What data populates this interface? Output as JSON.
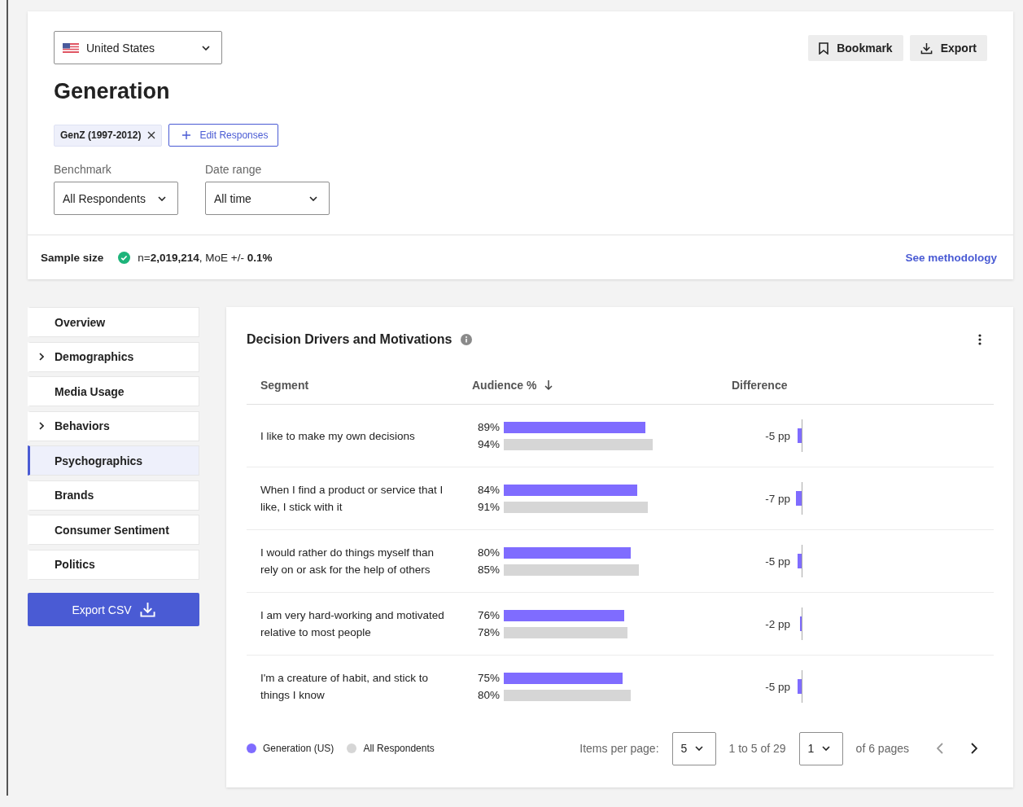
{
  "header": {
    "country": "United States",
    "title": "Generation",
    "actions": [
      {
        "label": "Bookmark",
        "kind": "bookmark"
      },
      {
        "label": "Export",
        "kind": "export"
      }
    ]
  },
  "filters": {
    "chips": [
      {
        "label": "GenZ (1997-2012)"
      }
    ],
    "edit_button": "Edit Responses",
    "benchmark": {
      "label": "Benchmark",
      "value": "All Respondents"
    },
    "date_range": {
      "label": "Date range",
      "value": "All time"
    }
  },
  "sample": {
    "label": "Sample size",
    "text": "n=**2,019,214**, MoE +/- **0.1%**",
    "link": "See methodology"
  },
  "nav": {
    "items": [
      {
        "label": "Overview",
        "expandable": false,
        "selected": false
      },
      {
        "label": "Demographics",
        "expandable": true,
        "selected": false
      },
      {
        "label": "Media Usage",
        "expandable": false,
        "selected": false
      },
      {
        "label": "Behaviors",
        "expandable": true,
        "selected": false
      },
      {
        "label": "Psychographics",
        "expandable": false,
        "selected": true
      },
      {
        "label": "Brands",
        "expandable": false,
        "selected": false
      },
      {
        "label": "Consumer Sentiment",
        "expandable": false,
        "selected": false
      },
      {
        "label": "Politics",
        "expandable": false,
        "selected": false
      }
    ],
    "export_button": "Export CSV"
  },
  "panel": {
    "title": "Decision Drivers and Motivations",
    "columns": [
      "Segment",
      "Audience %",
      "Difference"
    ],
    "rows": [
      {
        "segment": "I like to make my own decisions",
        "audience": {
          "value": "89%"
        },
        "benchmark": {
          "value": "94%"
        },
        "difference": {
          "value": "-5 pp"
        }
      },
      {
        "segment": "When I find a product or service that I like, I stick with it",
        "audience": {
          "value": "84%"
        },
        "benchmark": {
          "value": "91%"
        },
        "difference": {
          "value": "-7 pp"
        }
      },
      {
        "segment": "I would rather do things myself than rely on or ask for the help of others",
        "audience": {
          "value": "80%"
        },
        "benchmark": {
          "value": "85%"
        },
        "difference": {
          "value": "-5 pp"
        }
      },
      {
        "segment": "I am very hard-working and motivated relative to most people",
        "audience": {
          "value": "76%"
        },
        "benchmark": {
          "value": "78%"
        },
        "difference": {
          "value": "-2 pp"
        }
      },
      {
        "segment": "I'm a creature of habit, and stick to things I know",
        "audience": {
          "value": "75%"
        },
        "benchmark": {
          "value": "80%"
        },
        "difference": {
          "value": "-5 pp"
        }
      }
    ],
    "legend": [
      {
        "label": "Generation (US)",
        "color": "#7f6cff"
      },
      {
        "label": "All Respondents",
        "color": "#d6d6d6"
      }
    ],
    "pagination": {
      "items_label": "Items per page:",
      "page_size": "5",
      "range": "1 to 5 of 29",
      "page": "1",
      "pages": "of 6 pages",
      "previous_disabled": true,
      "next_disabled": false
    }
  }
}
